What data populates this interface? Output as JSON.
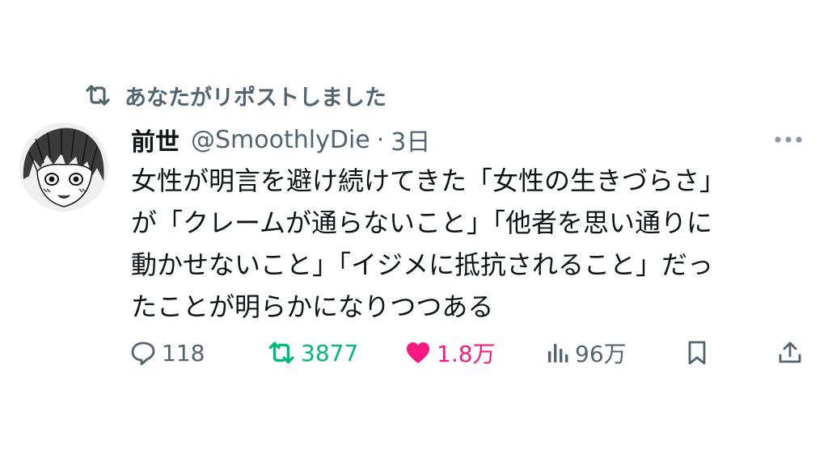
{
  "repost_banner": {
    "text": "あなたがリポストしました",
    "icon": "repost-icon"
  },
  "post": {
    "author": {
      "display_name": "前世",
      "handle": "@SmoothlyDie",
      "avatar": "manga-style-avatar"
    },
    "separator": "·",
    "time": "3日",
    "more_icon": "more-icon",
    "text_lines": [
      "女性が明言を避け続けてきた「女性の生きづらさ」",
      "が「クレームが通らないこと」「他者を思い通りに",
      "動かせないこと」「イジメに抵抗されること」だっ",
      "たことが明らかになりつつある"
    ]
  },
  "actions": {
    "reply": {
      "icon": "reply-icon",
      "count": "118"
    },
    "repost": {
      "icon": "repost-icon",
      "count": "3877",
      "active": true,
      "color": "#00ba7c"
    },
    "like": {
      "icon": "heart-icon",
      "count": "1.8万",
      "active": true,
      "color": "#f91880"
    },
    "views": {
      "icon": "views-icon",
      "count": "96万"
    },
    "bookmark": {
      "icon": "bookmark-icon"
    },
    "share": {
      "icon": "share-icon"
    }
  },
  "colors": {
    "text": "#0f1419",
    "secondary": "#536471",
    "repost_green": "#00ba7c",
    "like_pink": "#f91880"
  }
}
